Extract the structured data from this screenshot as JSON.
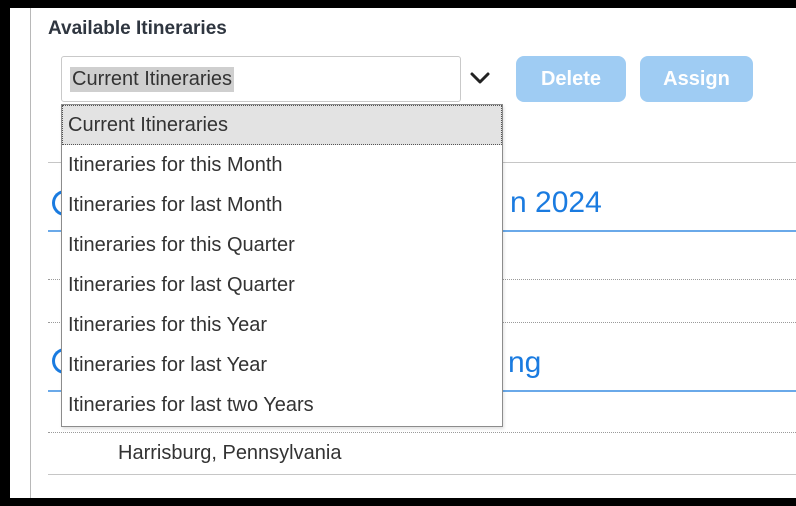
{
  "section": {
    "title": "Available Itineraries"
  },
  "filter": {
    "selected": "Current Itineraries",
    "options": [
      "Current Itineraries",
      "Itineraries for this Month",
      "Itineraries for last Month",
      "Itineraries for this Quarter",
      "Itineraries for last Quarter",
      "Itineraries for this Year",
      "Itineraries for last Year",
      "Itineraries for last two Years"
    ]
  },
  "actions": {
    "delete_label": "Delete",
    "assign_label": "Assign"
  },
  "itineraries": [
    {
      "title_fragment": "n 2024"
    },
    {
      "title_fragment": "ng",
      "location": "Harrisburg, Pennsylvania"
    }
  ],
  "colors": {
    "button_disabled": "#9fccf3",
    "link_blue": "#1a7be0",
    "accent_line": "#6aa9e9"
  }
}
